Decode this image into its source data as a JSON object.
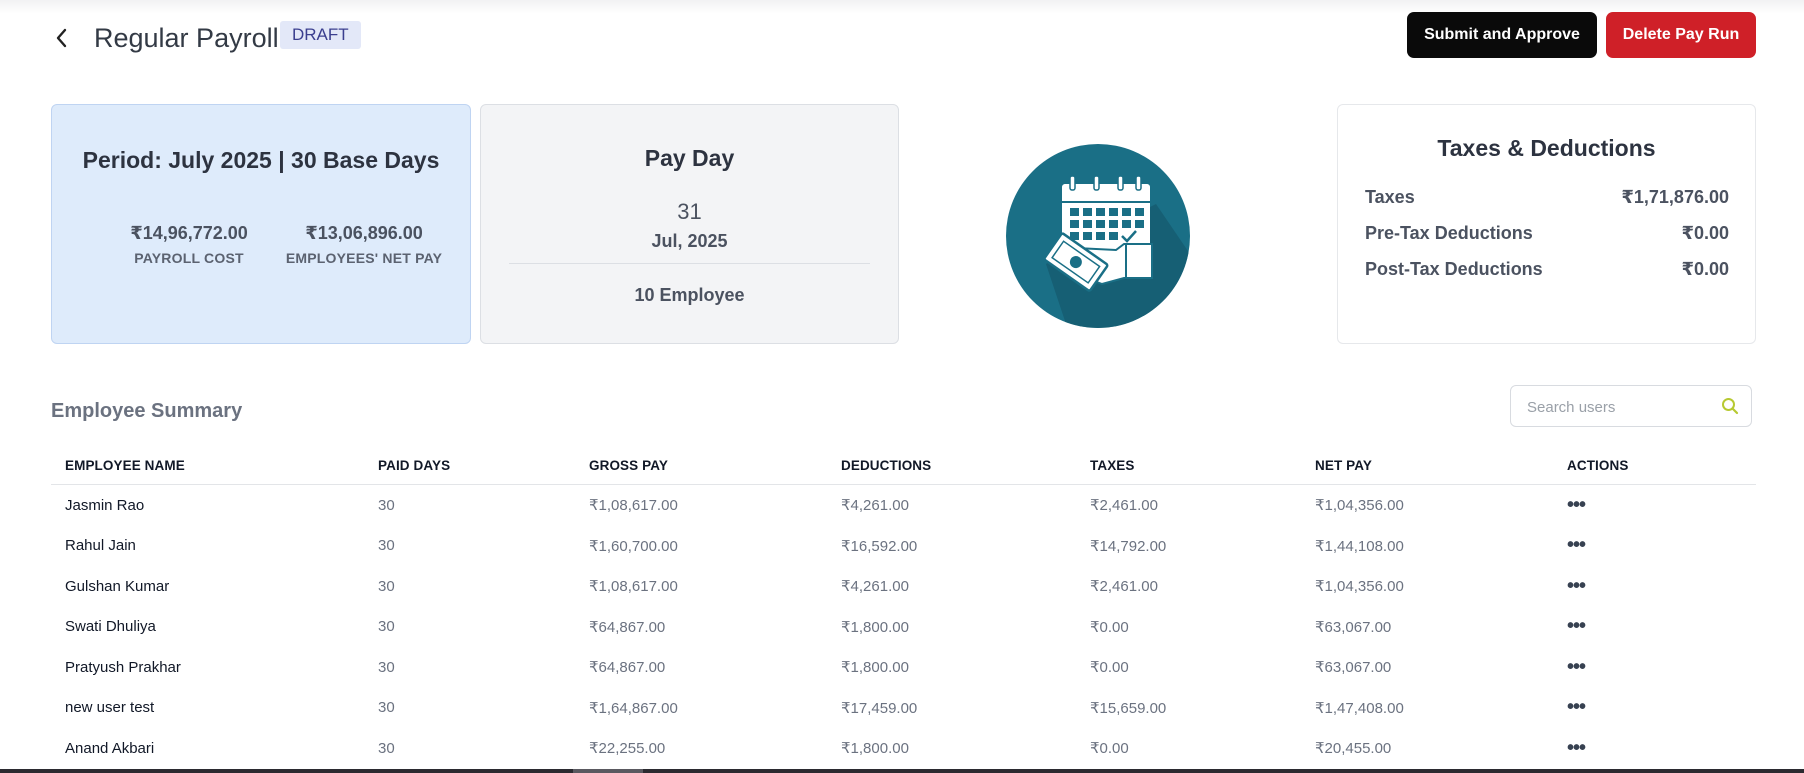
{
  "header": {
    "title": "Regular Payroll",
    "status_badge": "DRAFT",
    "submit_label": "Submit and Approve",
    "delete_label": "Delete Pay Run"
  },
  "period_card": {
    "title": "Period: July 2025 | 30 Base Days",
    "payroll_cost": "₹14,96,772.00",
    "payroll_cost_label": "PAYROLL COST",
    "net_pay": "₹13,06,896.00",
    "net_pay_label": "EMPLOYEES' NET PAY"
  },
  "payday_card": {
    "title": "Pay Day",
    "day": "31",
    "month_year": "Jul, 2025",
    "employees": "10 Employee"
  },
  "taxes_card": {
    "title": "Taxes & Deductions",
    "rows": [
      {
        "label": "Taxes",
        "value": "₹1,71,876.00"
      },
      {
        "label": "Pre-Tax Deductions",
        "value": "₹0.00"
      },
      {
        "label": "Post-Tax Deductions",
        "value": "₹0.00"
      }
    ]
  },
  "summary": {
    "title": "Employee Summary",
    "search_placeholder": "Search users",
    "columns": [
      "EMPLOYEE NAME",
      "PAID DAYS",
      "GROSS PAY",
      "DEDUCTIONS",
      "TAXES",
      "NET PAY",
      "ACTIONS"
    ],
    "actions_glyph": "•••",
    "rows": [
      {
        "name": "Jasmin Rao",
        "paid_days": "30",
        "gross": "₹1,08,617.00",
        "deductions": "₹4,261.00",
        "taxes": "₹2,461.00",
        "net": "₹1,04,356.00"
      },
      {
        "name": "Rahul Jain",
        "paid_days": "30",
        "gross": "₹1,60,700.00",
        "deductions": "₹16,592.00",
        "taxes": "₹14,792.00",
        "net": "₹1,44,108.00"
      },
      {
        "name": "Gulshan Kumar",
        "paid_days": "30",
        "gross": "₹1,08,617.00",
        "deductions": "₹4,261.00",
        "taxes": "₹2,461.00",
        "net": "₹1,04,356.00"
      },
      {
        "name": "Swati Dhuliya",
        "paid_days": "30",
        "gross": "₹64,867.00",
        "deductions": "₹1,800.00",
        "taxes": "₹0.00",
        "net": "₹63,067.00"
      },
      {
        "name": "Pratyush Prakhar",
        "paid_days": "30",
        "gross": "₹64,867.00",
        "deductions": "₹1,800.00",
        "taxes": "₹0.00",
        "net": "₹63,067.00"
      },
      {
        "name": "new user test",
        "paid_days": "30",
        "gross": "₹1,64,867.00",
        "deductions": "₹17,459.00",
        "taxes": "₹15,659.00",
        "net": "₹1,47,408.00"
      },
      {
        "name": "Anand Akbari",
        "paid_days": "30",
        "gross": "₹22,255.00",
        "deductions": "₹1,800.00",
        "taxes": "₹0.00",
        "net": "₹20,455.00"
      }
    ]
  },
  "icons": {
    "back": "chevron-left-icon",
    "search": "search-icon",
    "actions": "more-horizontal-icon",
    "illustration": "calendar-payment-icon"
  },
  "colors": {
    "submit_button": "#0a0a0a",
    "delete_button": "#cf2028",
    "period_card_bg": "#deebfb",
    "payday_card_bg": "#f3f4f6",
    "illustration_circle": "#1a6f86",
    "badge_bg": "#e3e8f8",
    "search_icon": "#b7c932"
  }
}
